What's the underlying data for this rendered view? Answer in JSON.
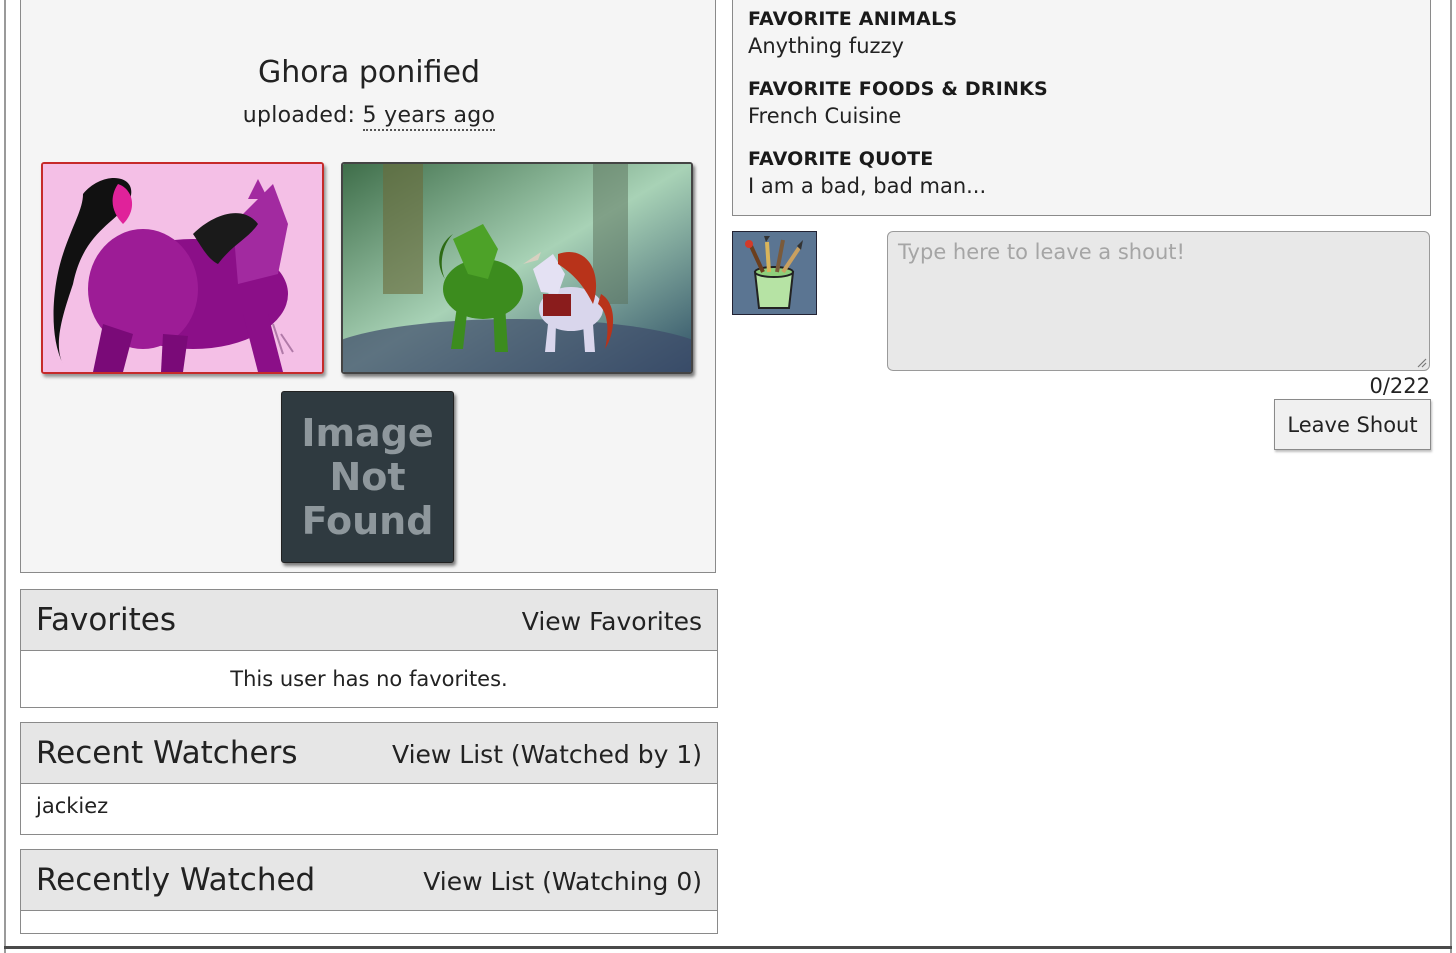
{
  "submission": {
    "title": "Ghora ponified",
    "uploaded_label": "uploaded:",
    "uploaded_time": "5 years ago",
    "image_not_found": "Image\nNot\nFound"
  },
  "favorites": {
    "heading": "Favorites",
    "link": "View Favorites",
    "empty_message": "This user has no favorites."
  },
  "recent_watchers": {
    "heading": "Recent Watchers",
    "link": "View List (Watched by 1)",
    "users": [
      "jackiez"
    ]
  },
  "recently_watched": {
    "heading": "Recently Watched",
    "link": "View List (Watching 0)"
  },
  "profile_info": {
    "animals_label": "FAVORITE ANIMALS",
    "animals_value": "Anything fuzzy",
    "foods_label": "FAVORITE FOODS & DRINKS",
    "foods_value": "French Cuisine",
    "quote_label": "FAVORITE QUOTE",
    "quote_value": "I am a bad, bad man..."
  },
  "shout": {
    "placeholder": "Type here to leave a shout!",
    "char_count": "0/222",
    "button": "Leave Shout"
  },
  "colors": {
    "panel_header_bg": "#e6e6e6",
    "box_bg": "#f5f5f5",
    "border": "#8a8a8a",
    "avatar_bg": "#5b7592"
  }
}
